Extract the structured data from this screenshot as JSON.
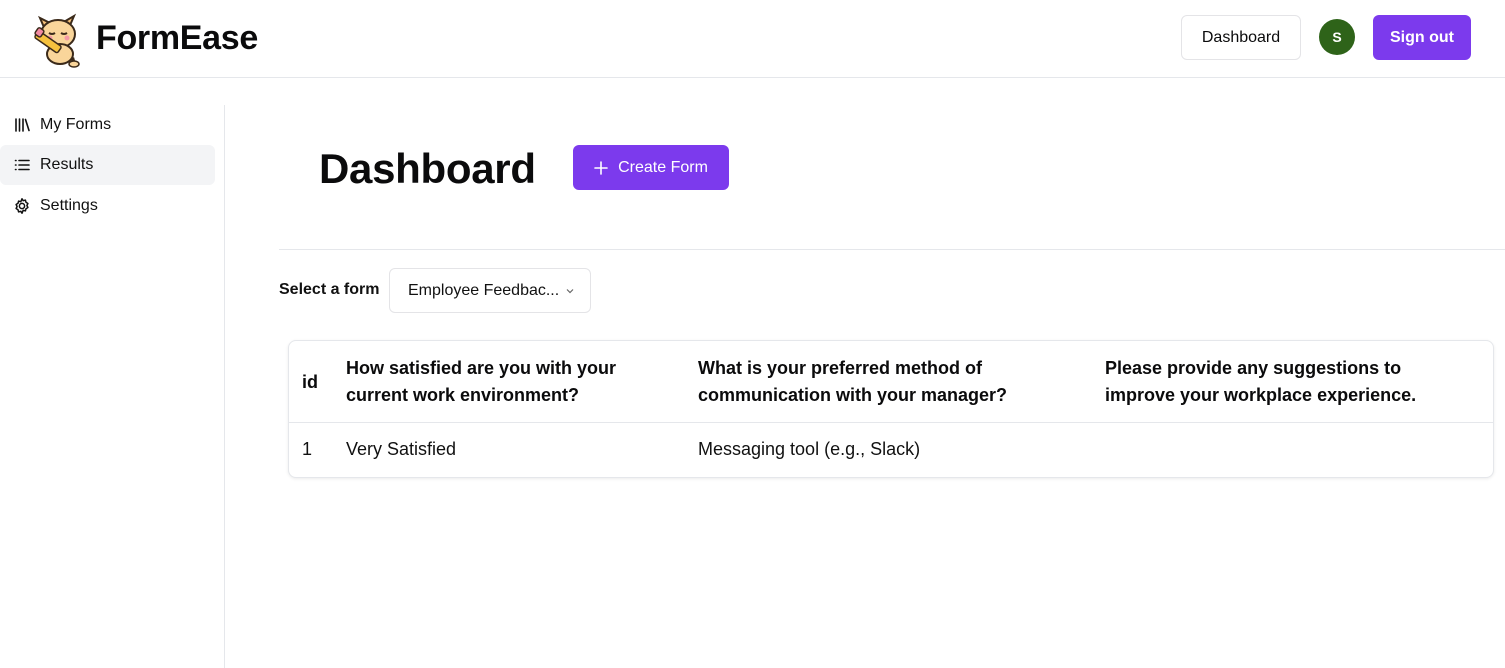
{
  "header": {
    "brand": "FormEase",
    "dashboard_label": "Dashboard",
    "avatar_initial": "S",
    "signout_label": "Sign out",
    "accent_color": "#7c3aed",
    "avatar_color": "#2e6319"
  },
  "sidebar": {
    "items": [
      {
        "label": "My Forms",
        "icon": "library-icon",
        "active": false
      },
      {
        "label": "Results",
        "icon": "list-icon",
        "active": true
      },
      {
        "label": "Settings",
        "icon": "gear-icon",
        "active": false
      }
    ]
  },
  "main": {
    "title": "Dashboard",
    "create_label": "Create Form",
    "select_label": "Select a form",
    "select_value": "Employee Feedbac...",
    "table": {
      "columns": [
        "id",
        "How satisfied are you with your current work environment?",
        "What is your preferred method of communication with your manager?",
        "Please provide any suggestions to improve your workplace experience."
      ],
      "rows": [
        [
          "1",
          "Very Satisfied",
          "Messaging tool (e.g., Slack)",
          ""
        ]
      ]
    }
  }
}
